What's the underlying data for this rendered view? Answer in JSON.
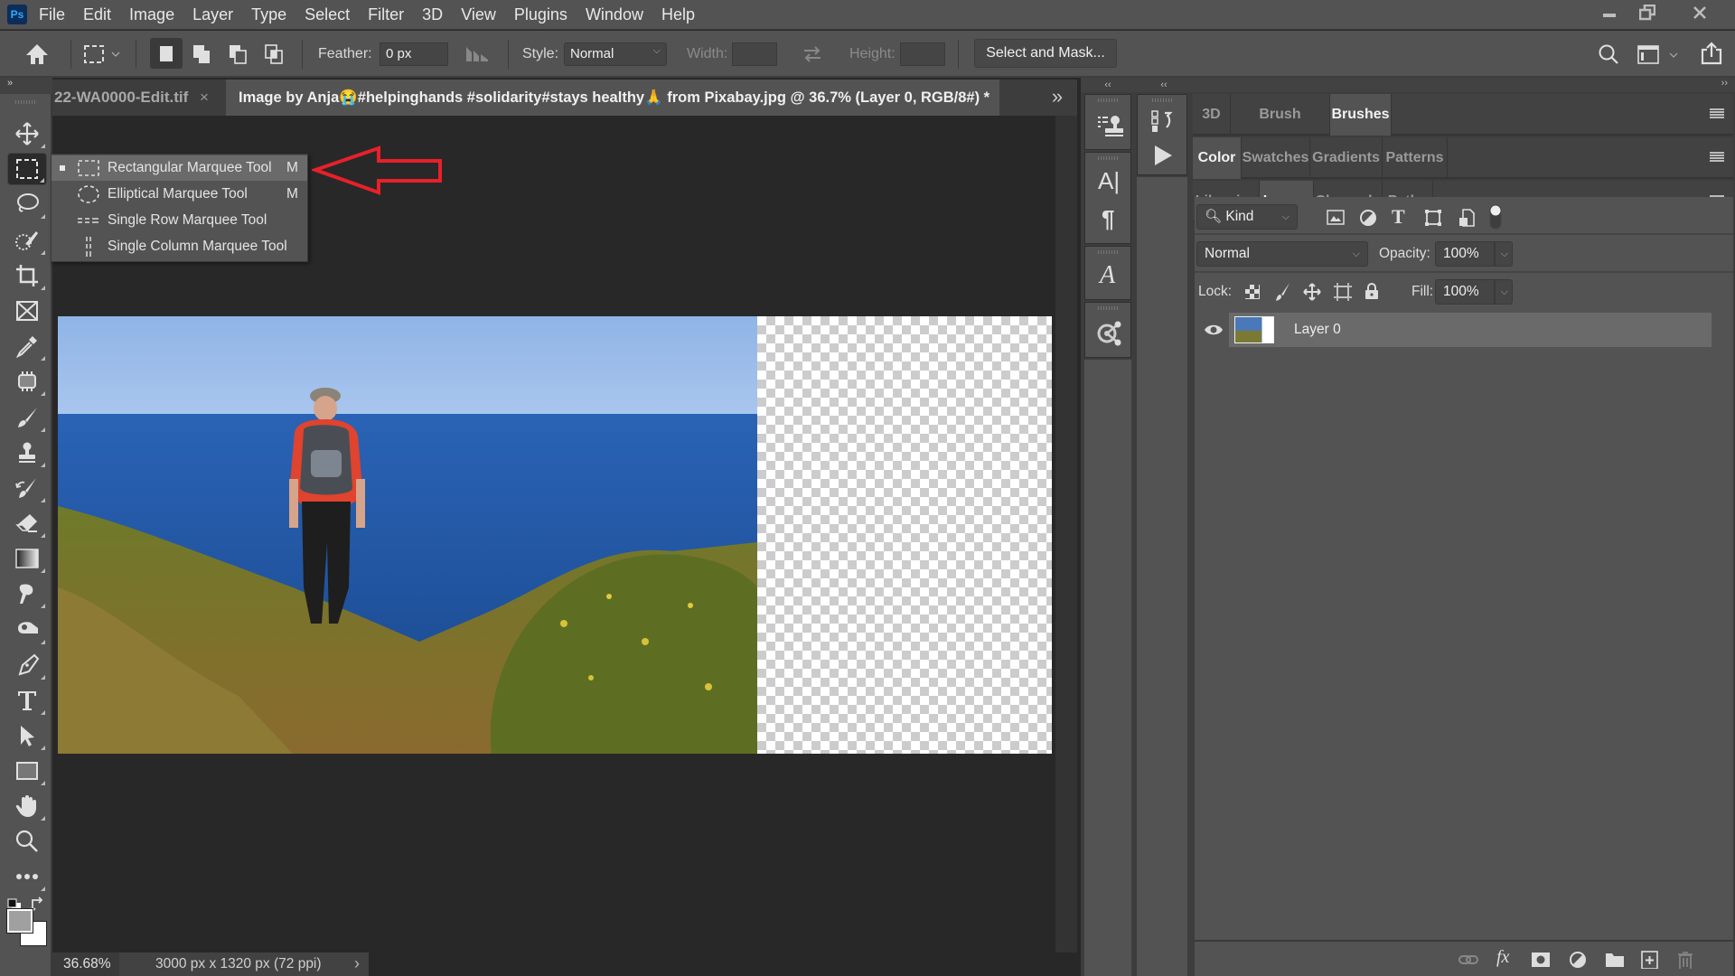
{
  "app": {
    "logo": "Ps",
    "menu": [
      "File",
      "Edit",
      "Image",
      "Layer",
      "Type",
      "Select",
      "Filter",
      "3D",
      "View",
      "Plugins",
      "Window",
      "Help"
    ],
    "window_controls": [
      "minimize-icon",
      "restore-icon",
      "close-icon"
    ]
  },
  "options_bar": {
    "feather_label": "Feather:",
    "feather_value": "0 px",
    "style_label": "Style:",
    "style_value": "Normal",
    "width_label": "Width:",
    "width_value": "",
    "height_label": "Height:",
    "height_value": "",
    "select_and_mask": "Select and Mask..."
  },
  "tabs": [
    {
      "label": "22-WA0000-Edit.tif",
      "close": "×",
      "active": false
    },
    {
      "label": "Image by Anja😭#helpinghands #solidarity#stays healthy🙏 from Pixabay.jpg @ 36.7% (Layer 0, RGB/8#) *",
      "close": "×",
      "active": true
    }
  ],
  "tab_overflow": "»",
  "flyout": {
    "items": [
      {
        "label": "Rectangular Marquee Tool",
        "shortcut": "M",
        "selected": true,
        "icon": "rectangular-marquee-icon"
      },
      {
        "label": "Elliptical Marquee Tool",
        "shortcut": "M",
        "selected": false,
        "icon": "elliptical-marquee-icon"
      },
      {
        "label": "Single Row Marquee Tool",
        "shortcut": "",
        "selected": false,
        "icon": "single-row-marquee-icon"
      },
      {
        "label": "Single Column Marquee Tool",
        "shortcut": "",
        "selected": false,
        "icon": "single-column-marquee-icon"
      }
    ]
  },
  "toolbar": {
    "tools": [
      "move",
      "rectangular-marquee",
      "lasso",
      "quick-selection",
      "crop",
      "frame",
      "eyedropper",
      "content-aware",
      "brush",
      "clone-stamp",
      "history-brush",
      "eraser",
      "gradient",
      "smudge",
      "dodge",
      "pen",
      "type",
      "path-selection",
      "rectangle",
      "hand",
      "zoom",
      "more"
    ],
    "foreground_color": "#a0a0a0",
    "background_color": "#ffffff"
  },
  "status": {
    "zoom": "36.68%",
    "doc_info": "3000 px x 1320 px (72 ppi)",
    "arrow": "›"
  },
  "panels": {
    "group1_tabs": [
      "3D",
      "Brush Settings",
      "Brushes"
    ],
    "group1_active": "Brushes",
    "group2_tabs": [
      "Color",
      "Swatches",
      "Gradients",
      "Patterns"
    ],
    "group2_active": "Color",
    "group3_tabs": [
      "Libraries",
      "Layers",
      "Channels",
      "Paths"
    ],
    "group3_active": "Layers",
    "filter_kind": "Kind",
    "blend_mode": "Normal",
    "opacity_label": "Opacity:",
    "opacity_value": "100%",
    "lock_label": "Lock:",
    "fill_label": "Fill:",
    "fill_value": "100%",
    "layers": [
      {
        "name": "Layer 0",
        "visible": true,
        "selected": true
      }
    ]
  },
  "annotation": {
    "arrow_color": "#e8202a"
  }
}
